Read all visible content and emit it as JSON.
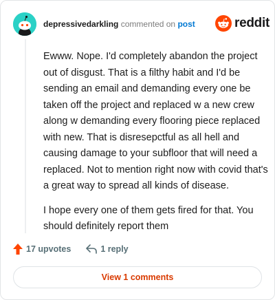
{
  "comment": {
    "username": "depressivedarkling",
    "meta_text": " commented on ",
    "post_link": "post",
    "paragraphs": [
      "Ewww. Nope. I'd completely abandon the project out of disgust. That is a filthy habit and I'd be sending an email and demanding every one be taken off the project and replaced w a new crew along w demanding every flooring piece replaced with new. That is disresepctful as all hell and causing damage to your subfloor that will need a replaced. Not to mention right now with covid that's a great way to spread all kinds of disease.",
      "I hope every one of them gets fired for that. You should definitely report them"
    ]
  },
  "brand": {
    "logo_text": "reddit",
    "color": "#ff4500"
  },
  "actions": {
    "upvotes": "17 upvotes",
    "reply": "1 reply",
    "upvote_icon": "upvote-arrow-icon",
    "reply_icon": "reply-arrow-icon"
  },
  "footer": {
    "view_comments": "View 1 comments"
  },
  "colors": {
    "avatar_bg": "#2bd1c6",
    "accent": "#d93a00",
    "link": "#0079d3"
  }
}
